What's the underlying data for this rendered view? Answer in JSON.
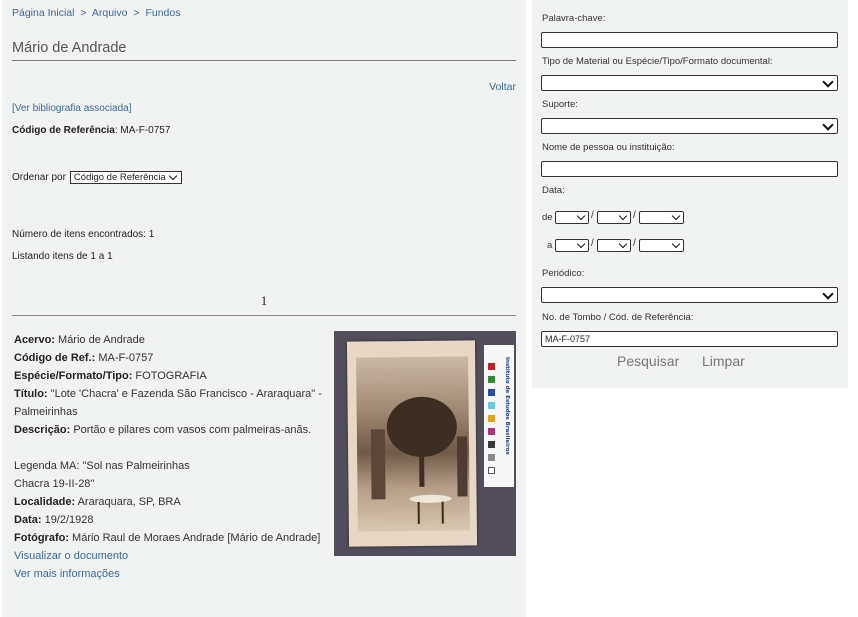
{
  "breadcrumb": {
    "home": "Página Inicial",
    "sep1": ">",
    "archive": "Arquivo",
    "sep2": ">",
    "fonds": "Fundos"
  },
  "page": {
    "title": "Mário de Andrade",
    "back": "Voltar",
    "bibliography_link": "[Ver bibliografia associada]",
    "ref_label": "Código de Referência",
    "ref_value": ": MA-F-0757",
    "sort_label": "Ordenar por",
    "sort_value": "Código de Referência",
    "items_found": "Número de itens encontrados: 1",
    "listing": "Listando itens de 1 a 1",
    "page_number": "1"
  },
  "record": {
    "acervo_label": "Acervo:",
    "acervo_value": " Mário de Andrade",
    "codref_label": "Código de Ref.:",
    "codref_value": " MA-F-0757",
    "especie_label": "Espécie/Formato/Tipo:",
    "especie_value": " FOTOGRAFIA",
    "titulo_label": "Título:",
    "titulo_value": " \"Lote 'Chacra' e Fazenda São Francisco - Araraquara\" - Palmeirinhas",
    "descricao_label": "Descrição:",
    "descricao_value": " Portão e pilares com vasos com palmeiras-anãs.",
    "legenda_line1": "Legenda MA: \"Sol nas Palmeirinhas",
    "legenda_line2": "Chacra 19-II-28\"",
    "localidade_label": "Localidade:",
    "localidade_value": " Araraquara, SP, BRA",
    "data_label": "Data:",
    "data_value": " 19/2/1928",
    "fotografo_label": "Fotógrafo:",
    "fotografo_value": " Mário Raul de Moraes Andrade [Mário de Andrade]",
    "view_document": "Visualizar o documento",
    "more_info": "Ver mais informações",
    "card_text": "Instituto de Estudos Brasileiros"
  },
  "search": {
    "keyword_label": "Palavra-chave:",
    "keyword_value": "",
    "material_label": "Tipo de Material ou Espécie/Tipo/Formato documental:",
    "support_label": "Suporte:",
    "person_label": "Nome de pessoa ou instituição:",
    "person_value": "",
    "date_label": "Data:",
    "date_from": "de",
    "date_to": "a",
    "slash": "/",
    "periodical_label": "Periódico:",
    "tombo_label": "No. de Tombo / Cód. de Referência:",
    "tombo_value": "MA-F-0757",
    "search_button": "Pesquisar",
    "clear_button": "Limpar"
  },
  "colors": {
    "link": "#3a6a9b",
    "panel_bg": "#f1f2f2",
    "swatches": [
      "#c0202a",
      "#2f8a3a",
      "#2a4aa8",
      "#6fc7de",
      "#e3a21b",
      "#a8327c",
      "#3a3a3a",
      "#8a8a8a",
      "#ffffff"
    ]
  }
}
